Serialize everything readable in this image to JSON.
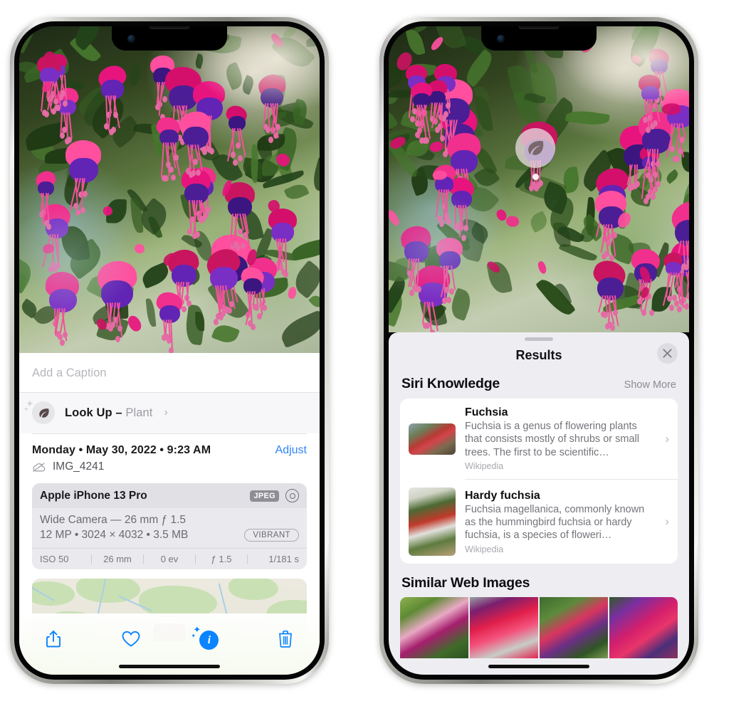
{
  "left_phone": {
    "name": "iPhone showing Photos info panel",
    "caption_placeholder": "Add a Caption",
    "lookup": {
      "icon": "leaf-icon",
      "label": "Look Up – ",
      "subject": "Plant",
      "chevron": "›"
    },
    "date_line": "Monday • May 30, 2022 • 9:23 AM",
    "adjust_label": "Adjust",
    "file_icon": "cloud-slash-icon",
    "file_name": "IMG_4241",
    "camera_card": {
      "model": "Apple iPhone 13 Pro",
      "format_chip": "JPEG",
      "lens_icon": "lens-icon",
      "lens_line": "Wide Camera — 26 mm ƒ 1.5",
      "size_line": "12 MP • 3024 × 4032 • 3.5 MB",
      "style_chip": "VIBRANT",
      "exif": [
        "ISO 50",
        "26 mm",
        "0 ev",
        "ƒ 1.5",
        "1/181 s"
      ]
    },
    "map_label": "photo location map",
    "toolbar": [
      {
        "name": "share-button",
        "icon": "share-icon"
      },
      {
        "name": "favorite-button",
        "icon": "heart-icon"
      },
      {
        "name": "info-button",
        "icon": "info-sparkle-icon",
        "glyph": "i"
      },
      {
        "name": "delete-button",
        "icon": "trash-icon"
      }
    ]
  },
  "right_phone": {
    "name": "iPhone showing Visual Look Up results",
    "leaf_badge_icon": "leaf-icon",
    "grabber": "sheet-grabber",
    "title": "Results",
    "close_icon": "close-icon",
    "siri_section": {
      "title": "Siri Knowledge",
      "show_more": "Show More",
      "items": [
        {
          "title": "Fuchsia",
          "description": "Fuchsia is a genus of flowering plants that consists mostly of shrubs or small trees. The first to be scientific…",
          "source": "Wikipedia",
          "thumb": "fuchsia-red-flowers-thumb",
          "chevron": "›"
        },
        {
          "title": "Hardy fuchsia",
          "description": "Fuchsia magellanica, commonly known as the hummingbird fuchsia or hardy fuchsia, is a species of floweri…",
          "source": "Wikipedia",
          "thumb": "hardy-fuchsia-branch-thumb",
          "chevron": "›"
        }
      ]
    },
    "web_section": {
      "title": "Similar Web Images",
      "images": [
        "web-image-pink-white-fuchsia",
        "web-image-red-fuchsia-closeup",
        "web-image-fuchsia-bush",
        "web-image-purple-fuchsia"
      ]
    }
  },
  "colors": {
    "accent_blue": "#0a84ff",
    "link_blue": "#2f86f6",
    "sheet_bg": "#eeeef2",
    "card_bg": "#ffffff",
    "meta_card_bg": "#eaeaee"
  }
}
